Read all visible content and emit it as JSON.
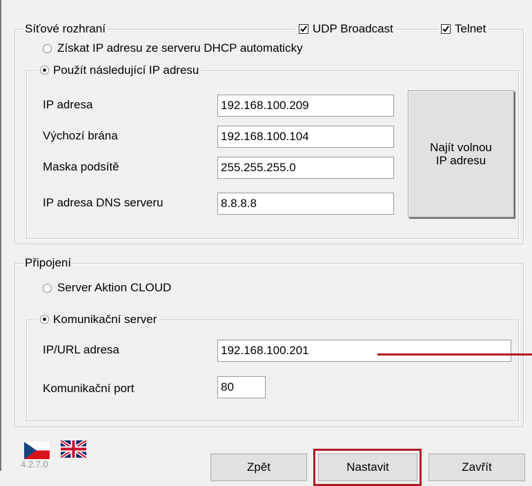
{
  "network_group": {
    "title": "Síťové rozhraní",
    "udp_broadcast": {
      "label": "UDP Broadcast",
      "checked": true
    },
    "telnet": {
      "label": "Telnet",
      "checked": true
    },
    "radio_dhcp": "Získat IP adresu ze serveru DHCP automaticky",
    "radio_static": "Použít následující IP adresu",
    "selected": "static",
    "fields": [
      {
        "label": "IP adresa",
        "value": "192.168.100.209"
      },
      {
        "label": "Výchozí brána",
        "value": "192.168.100.104"
      },
      {
        "label": "Maska podsítě",
        "value": "255.255.255.0"
      },
      {
        "label": "IP adresa DNS serveru",
        "value": "8.8.8.8"
      }
    ],
    "find_button": {
      "line1": "Najít volnou",
      "line2": "IP adresu"
    }
  },
  "connection_group": {
    "title": "Připojení",
    "radio_cloud": "Server Aktion CLOUD",
    "radio_comm": "Komunikační server",
    "selected": "comm",
    "fields": [
      {
        "label": "IP/URL adresa",
        "value": "192.168.100.201"
      },
      {
        "label": "Komunikační port",
        "value": "80"
      }
    ]
  },
  "footer": {
    "version": "4.2.7.0",
    "flags": [
      "czech-flag",
      "uk-flag"
    ],
    "buttons": {
      "back": "Zpět",
      "set": "Nastavit",
      "close": "Zavřít"
    }
  },
  "colors": {
    "highlight": "#b01c22",
    "background": "#f0f0f0"
  }
}
